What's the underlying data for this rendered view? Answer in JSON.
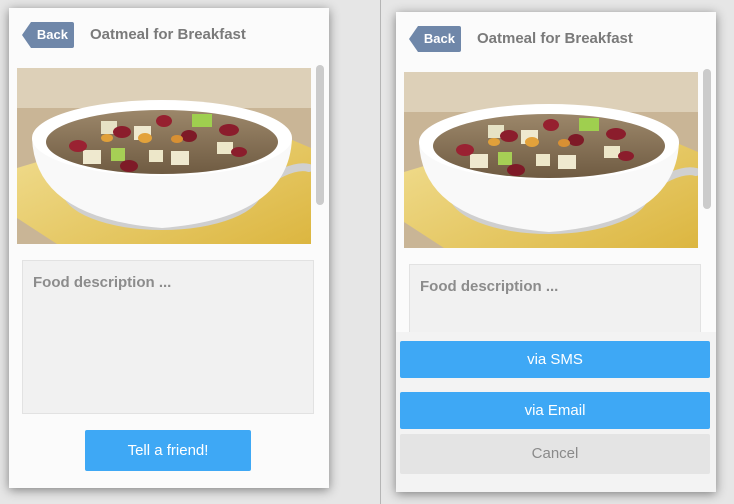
{
  "left_screen": {
    "back_label": "Back",
    "title": "Oatmeal for Breakfast",
    "description_placeholder": "Food description ...",
    "tell_friend_label": "Tell a friend!"
  },
  "right_screen": {
    "back_label": "Back",
    "title": "Oatmeal for Breakfast",
    "description_placeholder": "Food description ...",
    "share_sheet": {
      "sms_label": "via SMS",
      "email_label": "via Email",
      "cancel_label": "Cancel"
    }
  },
  "colors": {
    "accent": "#3ea8f5",
    "back_button": "#6f87a9",
    "title_text": "#7a7a7a"
  }
}
